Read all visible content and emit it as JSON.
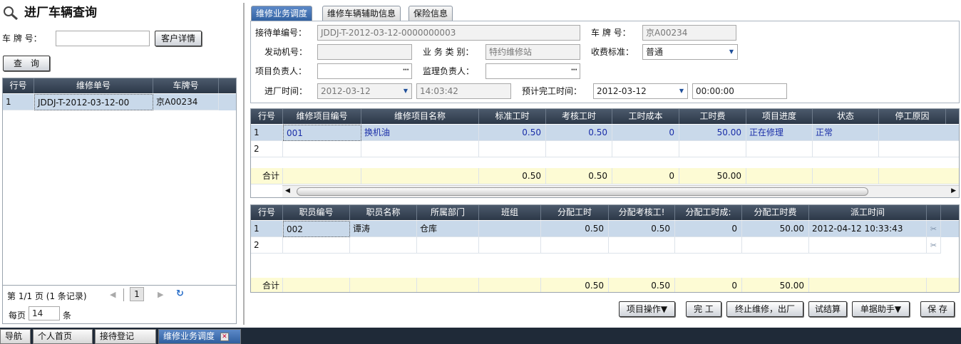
{
  "left": {
    "title": "进厂车辆查询",
    "plate_label": "车 牌 号：",
    "plate_value": "",
    "customer_button": "客户详情",
    "query_button": "查　询",
    "grid": {
      "headers": [
        "行号",
        "维修单号",
        "车牌号"
      ],
      "rows": [
        [
          "1",
          "JDDJ-T-2012-03-12-00",
          "京A00234"
        ]
      ]
    },
    "pager": {
      "info": "第 1/1 页 (1 条记录)",
      "page_number": "1",
      "per_page_label": "每页",
      "per_page_value": "14",
      "per_page_unit": "条"
    }
  },
  "tabs": [
    "维修业务调度",
    "维修车辆辅助信息",
    "保险信息"
  ],
  "form": {
    "order_label": "接待单编号：",
    "order_value": "JDDJ-T-2012-03-12-0000000003",
    "plate_label": "车 牌 号：",
    "plate_value": "京A00234",
    "engine_label": "发动机号：",
    "engine_value": "",
    "biz_label": "业 务 类 别：",
    "biz_value": "特约维修站",
    "fee_label": "收费标准：",
    "fee_value": "普通",
    "owner_label": "项目负责人：",
    "owner_value": "",
    "supervisor_label": "监理负责人：",
    "supervisor_value": "",
    "in_time_label": "进厂时间：",
    "in_date_value": "2012-03-12",
    "in_time_value": "14:03:42",
    "finish_label": "预计完工时间：",
    "finish_date_value": "2012-03-12",
    "finish_time_value": "00:00:00"
  },
  "items_grid": {
    "headers": [
      "行号",
      "维修项目编号",
      "维修项目名称",
      "标准工时",
      "考核工时",
      "工时成本",
      "工时费",
      "项目进度",
      "状态",
      "停工原因"
    ],
    "rows": [
      [
        "1",
        "001",
        "换机油",
        "0.50",
        "0.50",
        "0",
        "50.00",
        "正在修理",
        "正常",
        ""
      ],
      [
        "2",
        "",
        "",
        "",
        "",
        "",
        "",
        "",
        "",
        ""
      ]
    ],
    "summary": [
      "合计",
      "",
      "",
      "0.50",
      "0.50",
      "0",
      "50.00",
      "",
      "",
      ""
    ]
  },
  "staff_grid": {
    "headers": [
      "行号",
      "职员编号",
      "职员名称",
      "所属部门",
      "班组",
      "分配工时",
      "分配考核工!",
      "分配工时成:",
      "分配工时费",
      "派工时间"
    ],
    "rows": [
      [
        "1",
        "002",
        "谭涛",
        "仓库",
        "",
        "0.50",
        "0.50",
        "0",
        "50.00",
        "2012-04-12 10:33:43"
      ],
      [
        "2",
        "",
        "",
        "",
        "",
        "",
        "",
        "",
        "",
        ""
      ]
    ],
    "summary": [
      "合计",
      "",
      "",
      "",
      "",
      "0.50",
      "0.50",
      "0",
      "50.00",
      ""
    ]
  },
  "actions": [
    "项目操作▼",
    "完 工",
    "终止维修，出厂",
    "试结算",
    "单据助手▼",
    "保 存"
  ],
  "bottom_tabs": [
    "导航",
    "个人首页",
    "接待登记",
    "维修业务调度"
  ],
  "colors": {
    "header": "#2c3848",
    "selected_row": "#c9d9ea",
    "summary_row": "#fdfbd4",
    "active_tab": "#2f5f9f"
  }
}
